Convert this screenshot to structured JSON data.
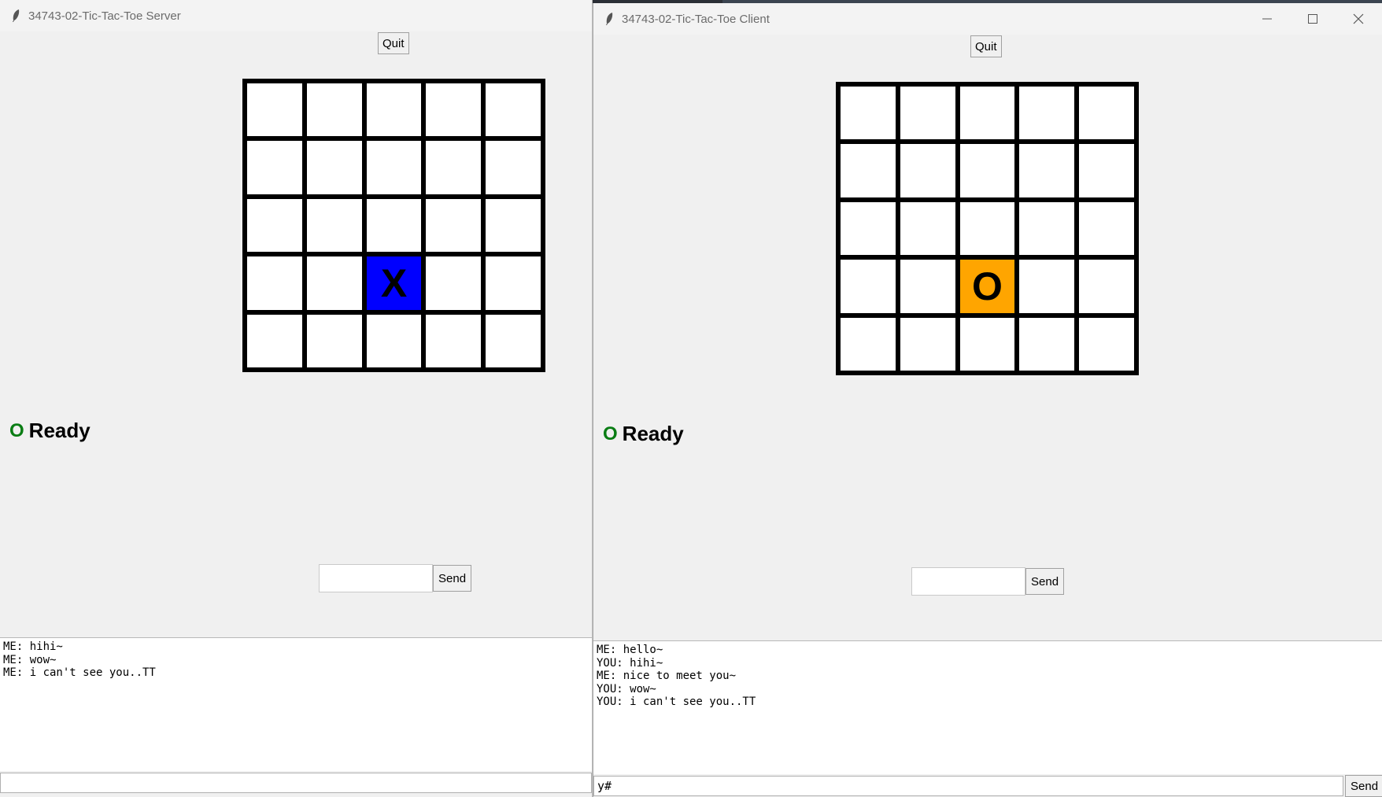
{
  "server": {
    "title": "34743-02-Tic-Tac-Toe Server",
    "quit_label": "Quit",
    "board": [
      [
        "",
        "",
        "",
        "",
        ""
      ],
      [
        "",
        "",
        "",
        "",
        ""
      ],
      [
        "",
        "",
        "",
        "",
        ""
      ],
      [
        "",
        "",
        "X",
        "",
        ""
      ],
      [
        "",
        "",
        "",
        "",
        ""
      ]
    ],
    "status": {
      "mark": "O",
      "text": "Ready"
    },
    "send_label": "Send",
    "message_value": "",
    "log": [
      "ME: hihi~",
      "ME: wow~",
      "ME: i can't see you..TT"
    ],
    "command_value": ""
  },
  "client": {
    "title": "34743-02-Tic-Tac-Toe Client",
    "quit_label": "Quit",
    "board": [
      [
        "",
        "",
        "",
        "",
        ""
      ],
      [
        "",
        "",
        "",
        "",
        ""
      ],
      [
        "",
        "",
        "",
        "",
        ""
      ],
      [
        "",
        "",
        "O",
        "",
        ""
      ],
      [
        "",
        "",
        "",
        "",
        ""
      ]
    ],
    "status": {
      "mark": "O",
      "text": "Ready"
    },
    "send_label": "Send",
    "message_value": "",
    "log": [
      "ME: hello~",
      "YOU: hihi~",
      "ME: nice to meet you~",
      "YOU: wow~",
      "YOU: i can't see you..TT"
    ],
    "command_value": "y#",
    "command_send_label": "Send",
    "window_controls": {
      "minimize": "minimize-icon",
      "maximize": "maximize-icon",
      "close": "close-icon"
    }
  },
  "colors": {
    "x_cell": "#0000ff",
    "o_cell": "#ffa500",
    "status_mark": "#0a7d14"
  }
}
